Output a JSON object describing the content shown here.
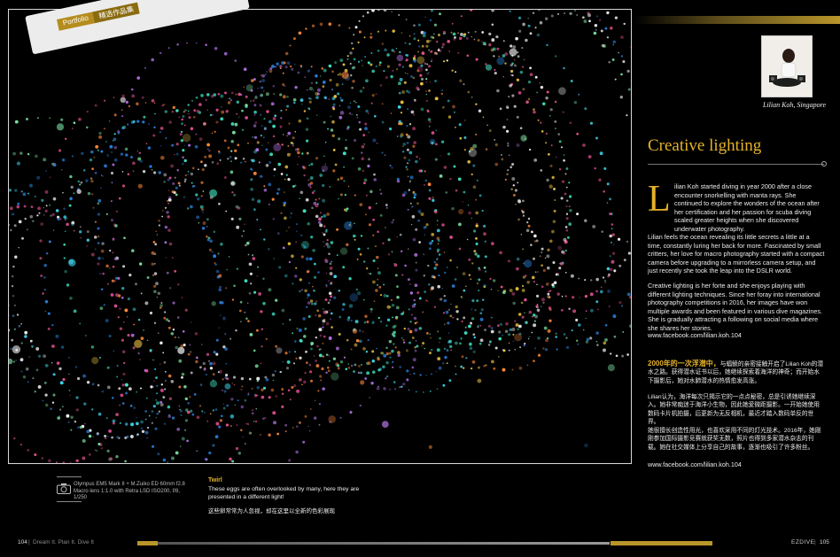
{
  "header": {
    "section_en": "Portfolio",
    "section_zh": "精选作品集"
  },
  "author": {
    "caption": "Lilian Koh, Singapore"
  },
  "article": {
    "title": "Creative lighting",
    "dropcap": "L",
    "p1": "ilian Koh started diving in year 2000 after a close encounter snorkelling with manta rays. She continued to explore the wonders of the ocean after her certification and her passion for scuba diving scaled greater heights when she discovered underwater photography.",
    "p2": "Lilian feels the ocean revealing its little secrets a little at a time, constantly luring her back for more. Fascinated by small critters, her love for macro photography started with a compact camera before upgrading to a mirrorless camera setup, and just recently she took the leap into the DSLR world.",
    "p3": "Creative lighting is her forte and she enjoys playing with different lighting techniques. Since her foray into international photography competitions in 2016, her images have won multiple awards and been featured in various dive magazines. She is gradually attracting a following on social media where she shares her stories.",
    "link": "www.facebook.com/lilian.koh.104",
    "zh_lead": "2000年的一次浮潜中，",
    "zh_p1": "与蝠鲼的亲密接触开启了Lilian Koh的潜水之路。获得潜水证书以后，她继续探索着海洋的神奇；而开始水下摄影后，她对水肺潜水的热情愈发高涨。",
    "zh_p2": "Lilian认为，海洋每次只揭示它的一点点秘密，总是引诱她继续深入。她非常痴迷于海洋小生物，因此她爱微距摄影。一开始她使用数码卡片机拍摄，后更新为无反相机，最近才踏入数码单反的世界。",
    "zh_p3": "她很擅长创造性用光，也喜欢采用不同的灯光技术。2016年，她刚刚参加国际摄影竞赛就获奖无数，照片也得到多家潜水杂志的刊载。她在社交媒体上分享自己的故事，逐渐也吸引了许多粉丝。",
    "zh_link": "www.facebook.com/lilian.koh.104"
  },
  "camera": {
    "specs": "Olympus EM5 Mark II + M.Zuiko ED 60mm f2.8 Macro lens 1:1.0 with Retra LSD ISO200, f/8, 1/250"
  },
  "caption": {
    "title": "Twirl",
    "text": "These eggs are often overlooked by many, here they are presented in a different light!",
    "zh": "这些卵常常为人忽视，却在这里以全新的色彩展现"
  },
  "footer": {
    "page_left": "104",
    "separator": "|",
    "tagline": "Dream It. Plan It. Dive It",
    "magazine": "EZDIVE",
    "page_right": "105"
  },
  "colors": {
    "accent_gold": "#e5b22a",
    "background": "#000000"
  }
}
